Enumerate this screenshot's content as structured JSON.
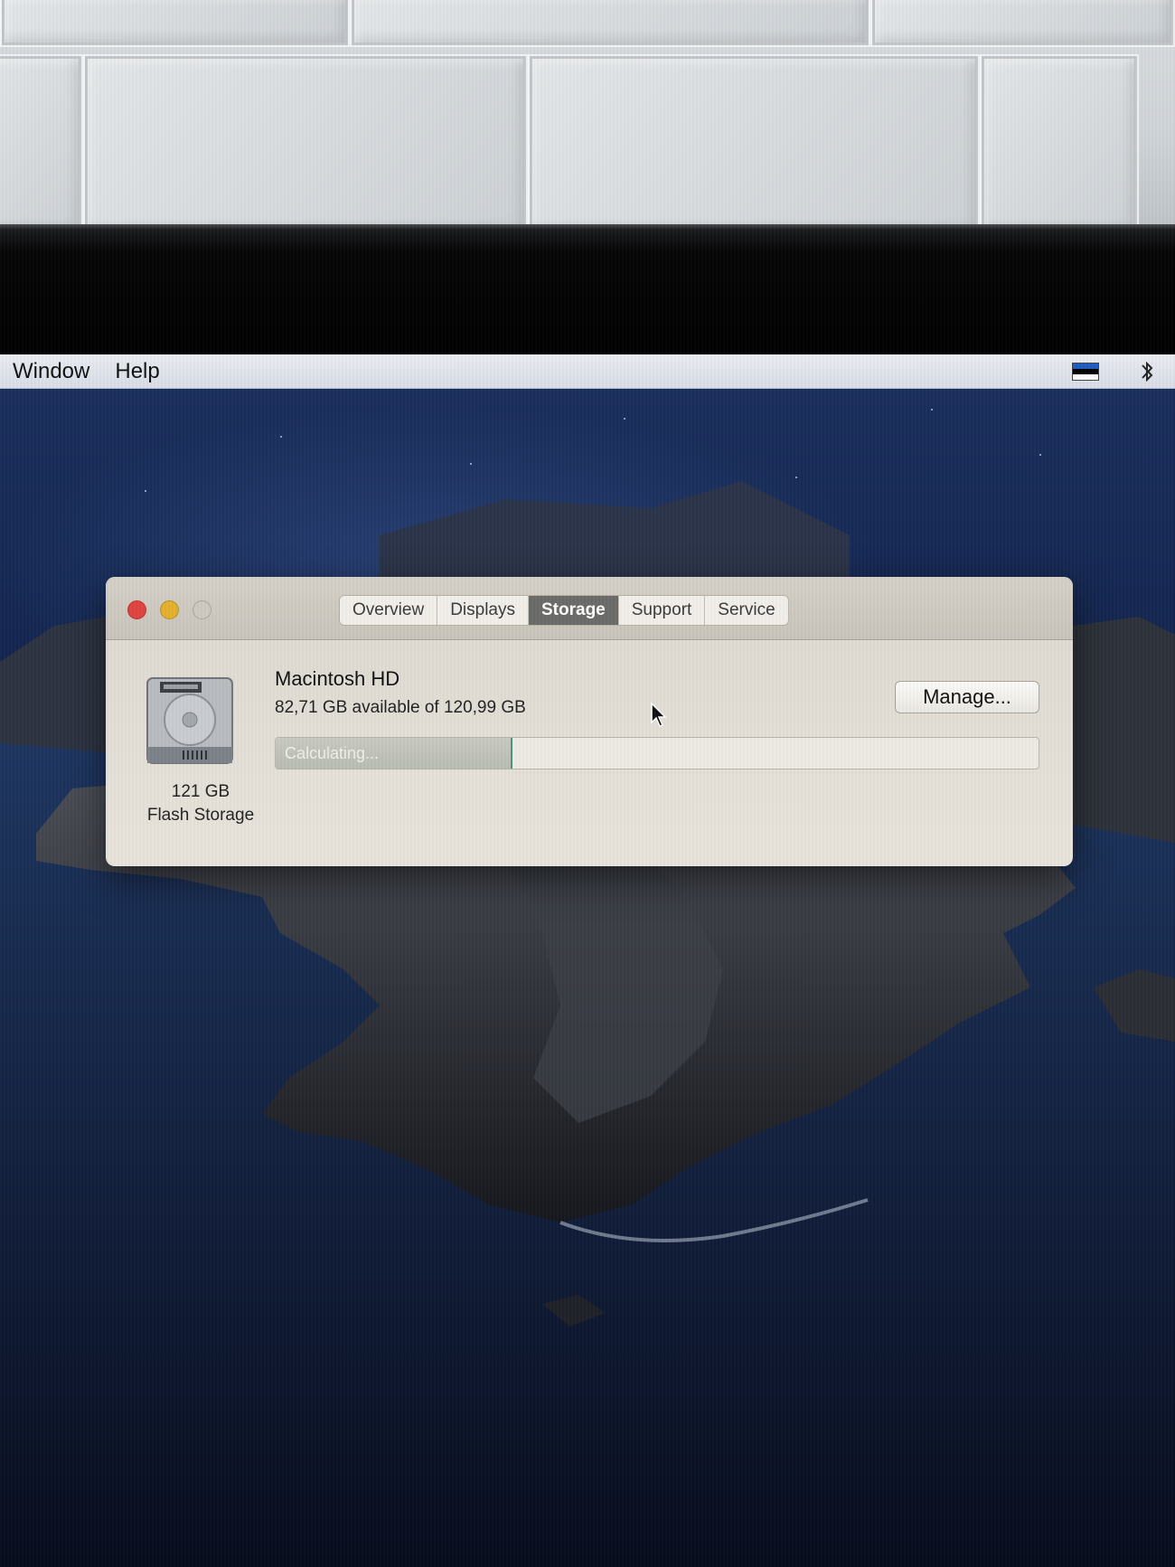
{
  "menubar": {
    "items": [
      "Window",
      "Help"
    ],
    "status_icons": [
      "flag-icon",
      "bluetooth-icon"
    ]
  },
  "window": {
    "tabs": [
      {
        "label": "Overview",
        "active": false
      },
      {
        "label": "Displays",
        "active": false
      },
      {
        "label": "Storage",
        "active": true
      },
      {
        "label": "Support",
        "active": false
      },
      {
        "label": "Service",
        "active": false
      }
    ],
    "storage": {
      "volume_name": "Macintosh HD",
      "availability": "82,71 GB available of 120,99 GB",
      "progress_text": "Calculating...",
      "progress_fraction": 0.31,
      "manage_label": "Manage...",
      "drive_size": "121 GB",
      "drive_type": "Flash Storage",
      "drive_icon": "hard-drive-icon"
    }
  },
  "colors": {
    "close": "#e0443e",
    "minimize": "#e3b12f",
    "zoom": "#cfcac1",
    "active_tab": "#6b6a68",
    "progress_border": "#4f8f86"
  }
}
